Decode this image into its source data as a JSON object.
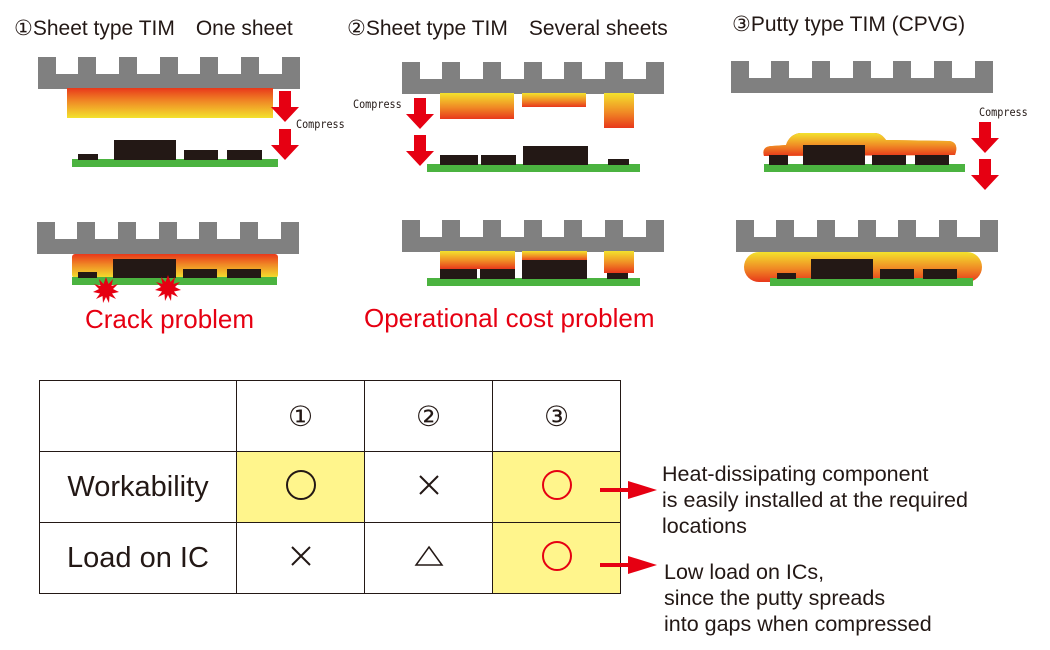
{
  "colors": {
    "heatsink": "#808080",
    "board": "#4bb340",
    "chip": "#231815",
    "tim_hot": "#e8381b",
    "tim_cool": "#f3e22d",
    "arrow": "#e60012",
    "highlight": "#fff58c",
    "problem_text": "#e60012"
  },
  "panels": [
    {
      "id": "1",
      "title": "①Sheet type TIM　One sheet",
      "compress_label": "Compress",
      "problem": "Crack problem"
    },
    {
      "id": "2",
      "title": "②Sheet type TIM　Several sheets",
      "compress_label": "Compress",
      "problem": "Operational cost problem"
    },
    {
      "id": "3",
      "title": "③Putty type TIM (CPVG)",
      "compress_label": "Compress",
      "problem": ""
    }
  ],
  "table": {
    "header": [
      "",
      "①",
      "②",
      "③"
    ],
    "rows": [
      {
        "label": "Workability",
        "cells": [
          {
            "symbol": "circle",
            "color": "#231815",
            "highlight": true
          },
          {
            "symbol": "cross",
            "color": "#231815",
            "highlight": false
          },
          {
            "symbol": "circle",
            "color": "#e60012",
            "highlight": true
          }
        ]
      },
      {
        "label": "Load on IC",
        "cells": [
          {
            "symbol": "cross",
            "color": "#231815",
            "highlight": false
          },
          {
            "symbol": "triangle",
            "color": "#231815",
            "highlight": false
          },
          {
            "symbol": "circle",
            "color": "#e60012",
            "highlight": true
          }
        ]
      }
    ]
  },
  "notes": [
    {
      "lines": [
        "Heat-dissipating component",
        "is easily installed at the required",
        "locations"
      ]
    },
    {
      "lines": [
        "Low load on ICs,",
        "since the putty spreads",
        "into gaps when compressed"
      ]
    }
  ]
}
